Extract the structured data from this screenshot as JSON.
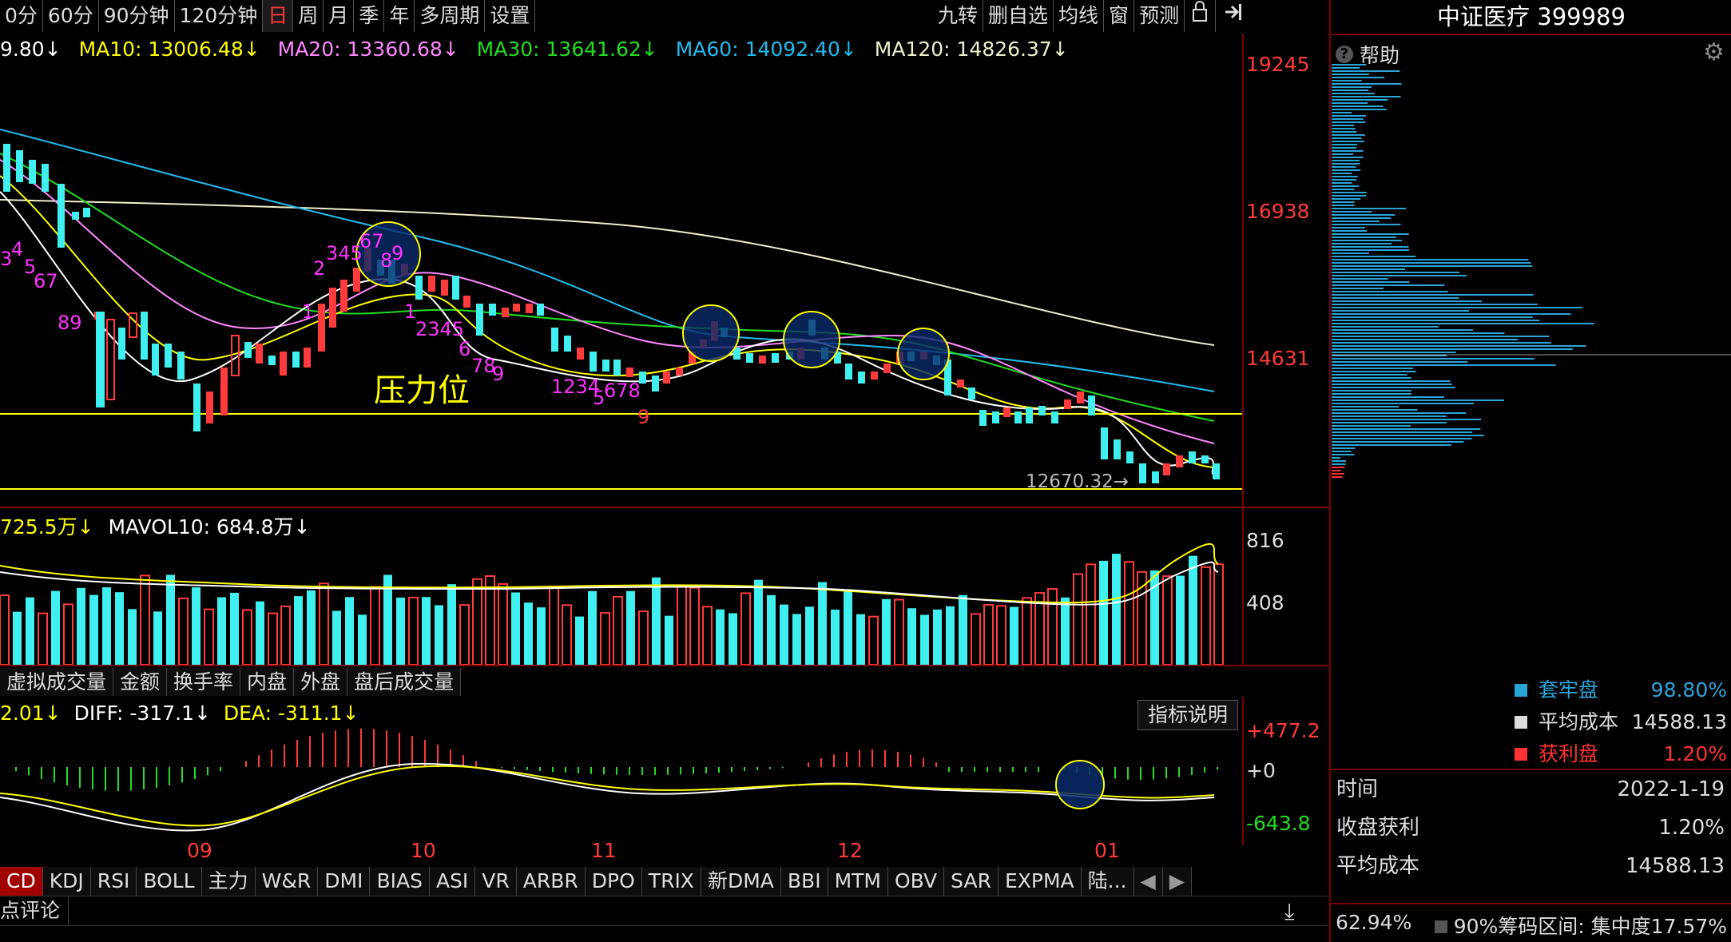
{
  "toolbar": {
    "periods": [
      "0分",
      "60分",
      "90分钟",
      "120分钟",
      "日",
      "周",
      "月",
      "季",
      "年",
      "多周期",
      "设置"
    ],
    "active_period": "日",
    "right": [
      "九转",
      "删自选",
      "均线",
      "窗",
      "预测"
    ]
  },
  "ma_line": {
    "ma5": "9.80↓",
    "ma10": "MA10: 13006.48↓",
    "ma20": "MA20: 13360.68↓",
    "ma30": "MA30: 13641.62↓",
    "ma60": "MA60: 14092.40↓",
    "ma120": "MA120: 14826.37↓"
  },
  "price_axis": [
    "19245",
    "16938",
    "14631"
  ],
  "low_label": "12670.32→",
  "annotation": "压力位",
  "td_labels": {
    "a1": "3",
    "a2": "4",
    "a3": "5",
    "a4": "67",
    "a5": "89",
    "b1": "2",
    "b2": "345",
    "b3": "67",
    "b4": "8",
    "b5": "9",
    "b6": "1",
    "c1": "1",
    "c2": "2345",
    "c3": "6",
    "c4": "78",
    "c5": "9",
    "d1": "1234",
    "d2": "5",
    "d3": "678",
    "d4": "9"
  },
  "volume": {
    "label1": "725.5万↓",
    "label2": "MAVOL10: 684.8万↓",
    "axis": [
      "816",
      "408"
    ]
  },
  "vol_tabs": [
    "虚拟成交量",
    "金额",
    "换手率",
    "内盘",
    "外盘",
    "盘后成交量"
  ],
  "macd": {
    "label0": "2.01↓",
    "diff": "DIFF: -317.1↓",
    "dea": "DEA: -311.1↓",
    "explain": "指标说明",
    "axis": [
      "+477.2",
      "+0",
      "-643.8"
    ]
  },
  "months": [
    "09",
    "10",
    "11",
    "12",
    "01"
  ],
  "indicator_tabs": [
    "CD",
    "KDJ",
    "RSI",
    "BOLL",
    "主力",
    "W&R",
    "DMI",
    "BIAS",
    "ASI",
    "VR",
    "ARBR",
    "DPO",
    "TRIX",
    "新DMA",
    "BBI",
    "MTM",
    "OBV",
    "SAR",
    "EXPMA",
    "陆..."
  ],
  "active_indicator": "CD",
  "comment_tab": "点评论",
  "right_panel": {
    "title": "中证医疗 399989",
    "help": "帮助",
    "legend": [
      {
        "label": "套牢盘",
        "value": "98.80%",
        "color": "#2aa5d8"
      },
      {
        "label": "平均成本",
        "value": "14588.13",
        "color": "#dddddd"
      },
      {
        "label": "获利盘",
        "value": "1.20%",
        "color": "#ff3333"
      }
    ],
    "rows": [
      {
        "label": "时间",
        "value": "2022-1-19"
      },
      {
        "label": "收盘获利",
        "value": "1.20%"
      },
      {
        "label": "平均成本",
        "value": "14588.13"
      }
    ],
    "footer_left": "62.94%",
    "footer_right": "90%筹码区间: 集中度17.57%"
  },
  "colors": {
    "up": "#ff3b3b",
    "down": "#40f0f0",
    "ma5": "#ffffff",
    "ma10": "#ffff00",
    "ma20": "#ff88ff",
    "ma30": "#22dd22",
    "ma60": "#22bbee",
    "ma120": "#eeeecc"
  }
}
